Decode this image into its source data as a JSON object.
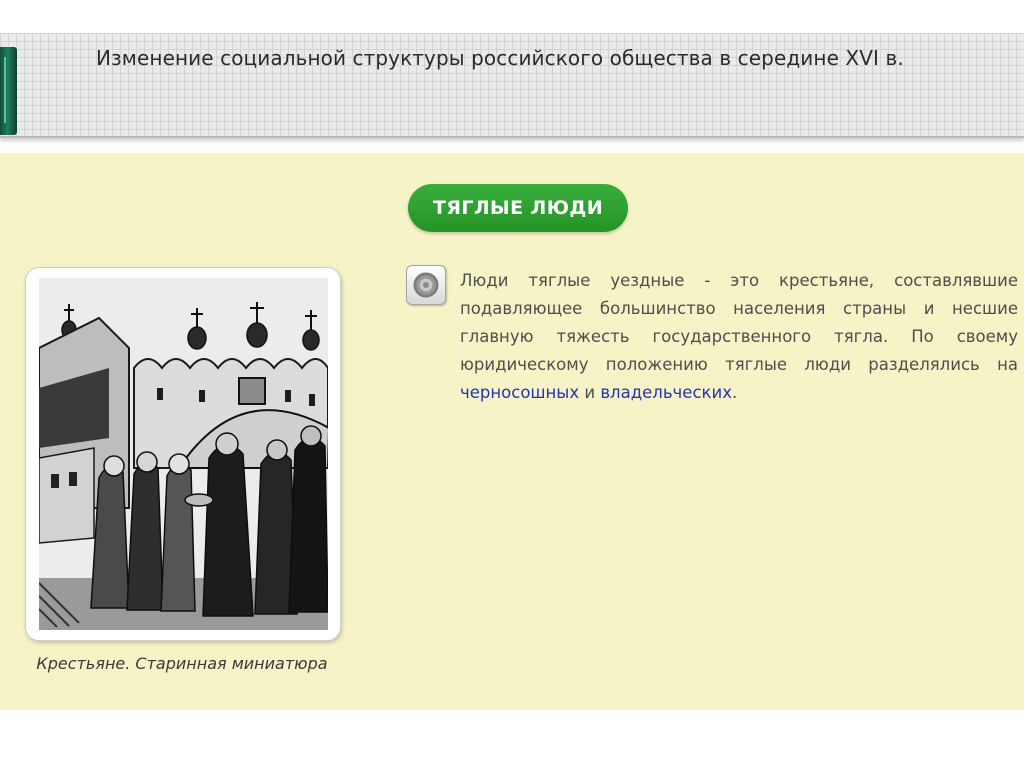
{
  "header": {
    "title": "Изменение социальной структуры российского общества в середине XVI в."
  },
  "section": {
    "title": "ТЯГЛЫЕ ЛЮДИ"
  },
  "paragraph": {
    "text_before": "Люди тяглые уездные - это крестьяне, составлявшие подавляющее большинство населения страны и несшие главную тяжесть государственного тягла. По своему юридическому положению тяглые люди разделялись на ",
    "link_chernososhnye": "черносошных",
    "conjunction": " и ",
    "link_vladelcheskie": "владельческих",
    "text_after": "."
  },
  "image": {
    "caption": "Крестьяне. Старинная миниатюра"
  },
  "icons": {
    "sound": "speaker-icon",
    "book": "book-spine-icon"
  },
  "colors": {
    "content_background": "#f6f3c7",
    "pill_green": "#2e9f31",
    "link_blue": "#2234b4",
    "text_gray": "#4e4e4e"
  }
}
